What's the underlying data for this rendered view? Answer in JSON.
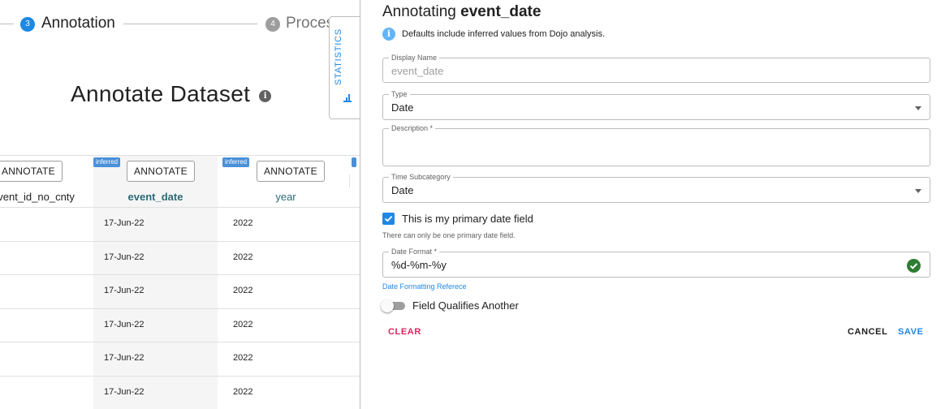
{
  "stepper": {
    "step3": {
      "number": "3",
      "label": "Annotation",
      "color": "#1e88e5"
    },
    "step4": {
      "number": "4",
      "label": "Process",
      "color": "#9e9e9e"
    }
  },
  "page": {
    "title": "Annotate Dataset",
    "info_icon": "info-icon"
  },
  "statistics_tab": {
    "label": "STATISTICS",
    "icon": "bar-chart-icon"
  },
  "table": {
    "annotate_label": "ANNOTATE",
    "inferred_label": "inferred",
    "columns": [
      {
        "name": "event_id_no_cnty",
        "highlighted": false
      },
      {
        "name": "event_date",
        "highlighted": true
      },
      {
        "name": "year",
        "highlighted": false
      }
    ],
    "rows": [
      {
        "event_date": "17-Jun-22",
        "year": "2022"
      },
      {
        "event_date": "17-Jun-22",
        "year": "2022"
      },
      {
        "event_date": "17-Jun-22",
        "year": "2022"
      },
      {
        "event_date": "17-Jun-22",
        "year": "2022"
      },
      {
        "event_date": "17-Jun-22",
        "year": "2022"
      },
      {
        "event_date": "17-Jun-22",
        "year": "2022"
      }
    ]
  },
  "drawer": {
    "title_prefix": "Annotating ",
    "title_field": "event_date",
    "hint": "Defaults include inferred values from Dojo analysis.",
    "display_name": {
      "label": "Display Name",
      "placeholder": "event_date",
      "value": ""
    },
    "type": {
      "label": "Type",
      "value": "Date"
    },
    "description": {
      "label": "Description *",
      "value": ""
    },
    "time_subcategory": {
      "label": "Time Subcategory",
      "value": "Date"
    },
    "primary_date": {
      "label": "This is my primary date field",
      "checked": true,
      "helper": "There can only be one primary date field."
    },
    "date_format": {
      "label": "Date Format *",
      "value": "%d-%m-%y",
      "valid": true
    },
    "date_reference_link": "Date Formatting Referece",
    "qualifies": {
      "label": "Field Qualifies Another",
      "on": false
    },
    "actions": {
      "clear": "CLEAR",
      "cancel": "CANCEL",
      "save": "SAVE"
    }
  },
  "colors": {
    "primary": "#1e88e5",
    "danger": "#e0245e",
    "success": "#2e7d32",
    "teal_header": "#2b6b76"
  }
}
